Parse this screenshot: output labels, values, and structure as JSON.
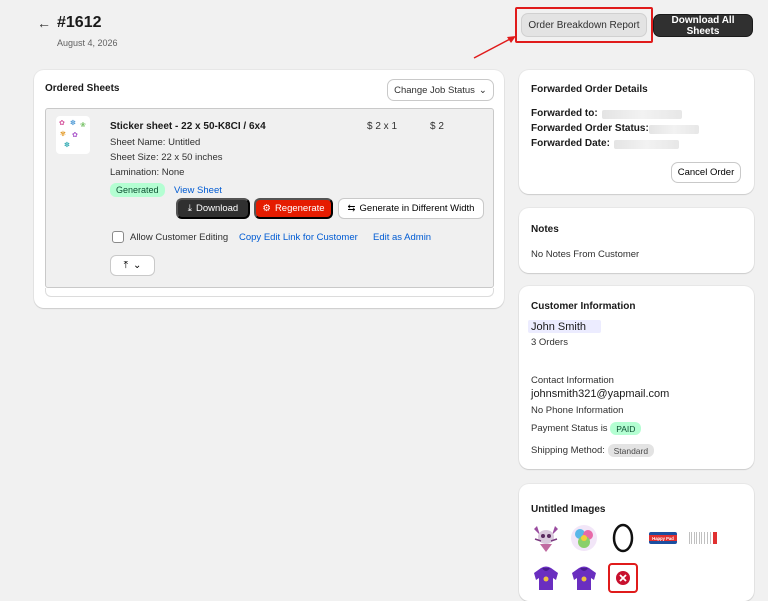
{
  "header": {
    "back_icon": "arrow-left-icon",
    "order_number": "#1612",
    "date": "August 4, 2026",
    "report_button": "Order Breakdown Report",
    "download_all_button": "Download All Sheets"
  },
  "ordered_sheets": {
    "title": "Ordered Sheets",
    "change_status_button": "Change Job Status",
    "item": {
      "title": "Sticker sheet - 22 x 50-K8CI / 6x4",
      "sheet_name": "Sheet Name: Untitled",
      "sheet_size": "Sheet Size: 22 x 50 inches",
      "lamination": "Lamination: None",
      "quantity_price": "$ 2 x 1",
      "total": "$ 2",
      "status_badge": "Generated",
      "view_sheet_link": "View Sheet",
      "download_button": "Download",
      "regenerate_button": "Regenerate",
      "generate_width_button": "Generate in Different Width",
      "allow_editing_label": "Allow Customer Editing",
      "copy_link": "Copy Edit Link for Customer",
      "edit_admin_link": "Edit as Admin"
    }
  },
  "forwarded": {
    "title": "Forwarded Order Details",
    "to_label": "Forwarded to:",
    "status_label": "Forwarded Order Status:",
    "date_label": "Forwarded Date:",
    "cancel_button": "Cancel Order"
  },
  "notes": {
    "title": "Notes",
    "text": "No Notes From Customer"
  },
  "customer": {
    "title": "Customer Information",
    "name": "John Smith",
    "orders": "3 Orders",
    "contact_title": "Contact Information",
    "email": "johnsmith321@yapmail.com",
    "phone": "No Phone Information",
    "payment_label": "Payment Status is",
    "payment_status": "PAID",
    "shipping_label": "Shipping Method:",
    "shipping_method": "Standard"
  },
  "images": {
    "title": "Untitled Images",
    "happy_pad_label": "Happy Pad"
  },
  "colors": {
    "accent_red": "#e51c00",
    "link_blue": "#005bd3",
    "dark_button": "#303030",
    "success_bg": "#b4fed2",
    "annotation_red": "#e01b1b"
  }
}
